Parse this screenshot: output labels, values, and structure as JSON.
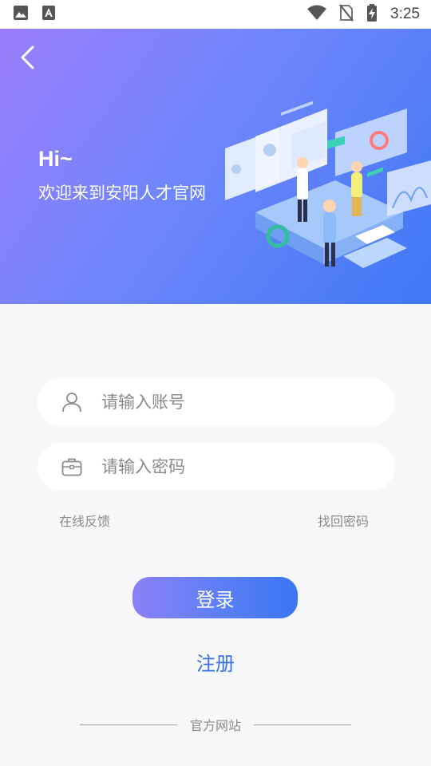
{
  "status_bar": {
    "time": "3:25"
  },
  "header": {
    "greeting": "Hi~",
    "welcome": "欢迎来到安阳人才官网"
  },
  "form": {
    "account_placeholder": "请输入账号",
    "password_placeholder": "请输入密码"
  },
  "links": {
    "feedback": "在线反馈",
    "forgot_password": "找回密码"
  },
  "actions": {
    "login": "登录",
    "register": "注册"
  },
  "footer": {
    "official_site": "官方网站"
  },
  "colors": {
    "accent": "#3c6fe3",
    "banner_start": "#9b7dfb",
    "banner_end": "#3f78f5"
  }
}
